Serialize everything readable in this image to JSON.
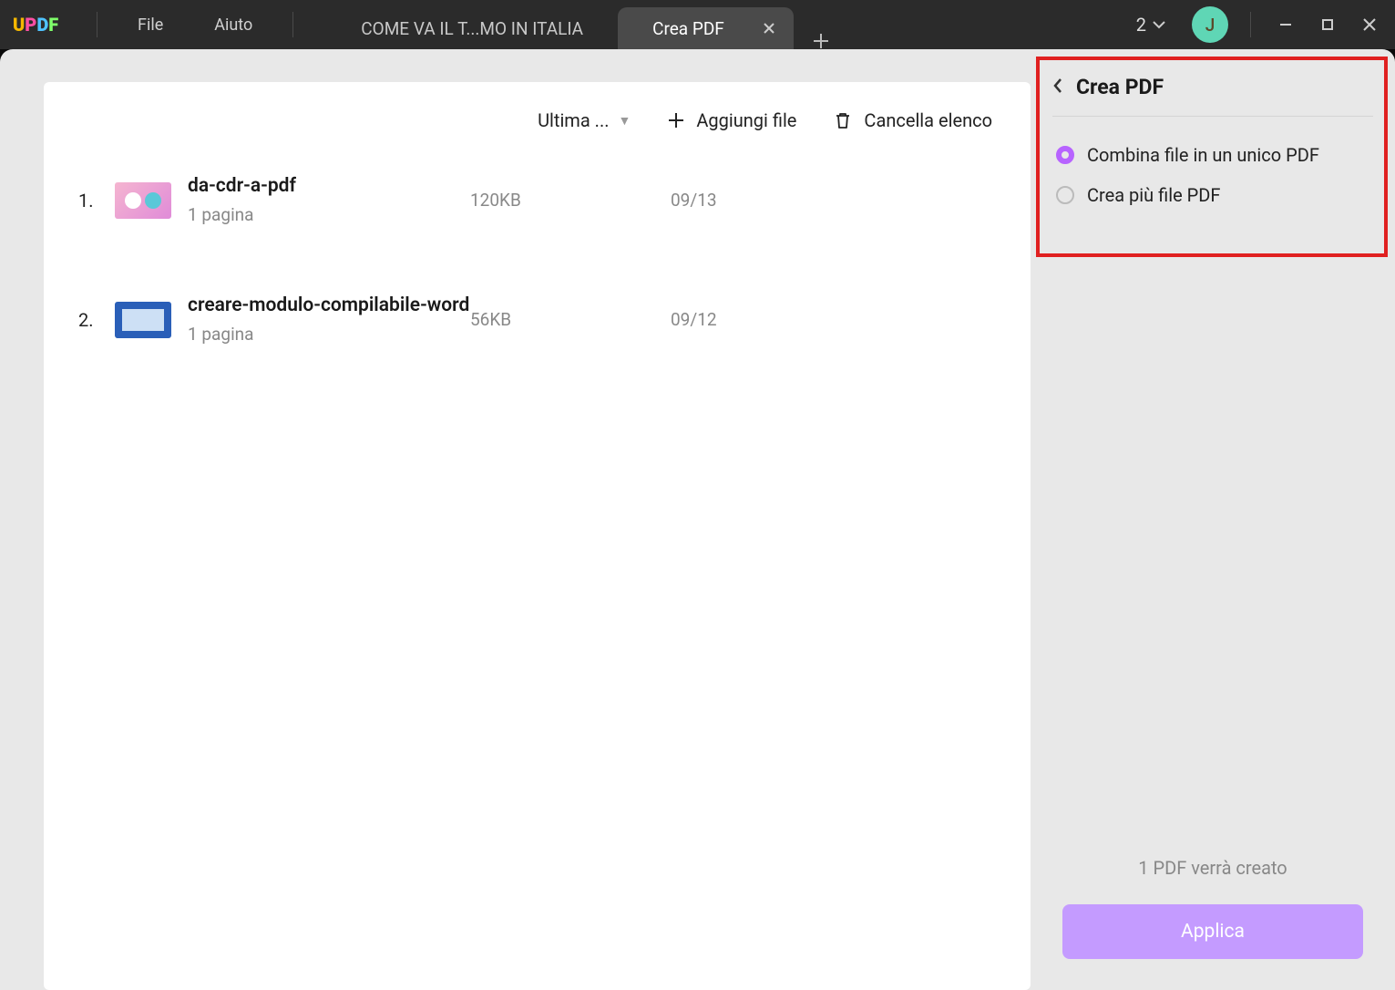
{
  "titlebar": {
    "menu_file": "File",
    "menu_help": "Aiuto",
    "window_count": "2"
  },
  "tabs": {
    "inactive_label": "COME VA IL T...MO IN ITALIA",
    "active_label": "Crea PDF"
  },
  "avatar_initial": "J",
  "toolbar": {
    "sort_label": "Ultima ...",
    "add_file": "Aggiungi file",
    "clear_list": "Cancella elenco"
  },
  "files": [
    {
      "idx": "1.",
      "name": "da-cdr-a-pdf",
      "pages": "1 pagina",
      "size": "120KB",
      "date": "09/13"
    },
    {
      "idx": "2.",
      "name": "creare-modulo-compilabile-word",
      "pages": "1 pagina",
      "size": "56KB",
      "date": "09/12"
    }
  ],
  "panel": {
    "title": "Crea PDF",
    "option_combine": "Combina file in un unico PDF",
    "option_multi": "Crea più file PDF",
    "footnote": "1 PDF verrà creato",
    "apply": "Applica"
  }
}
